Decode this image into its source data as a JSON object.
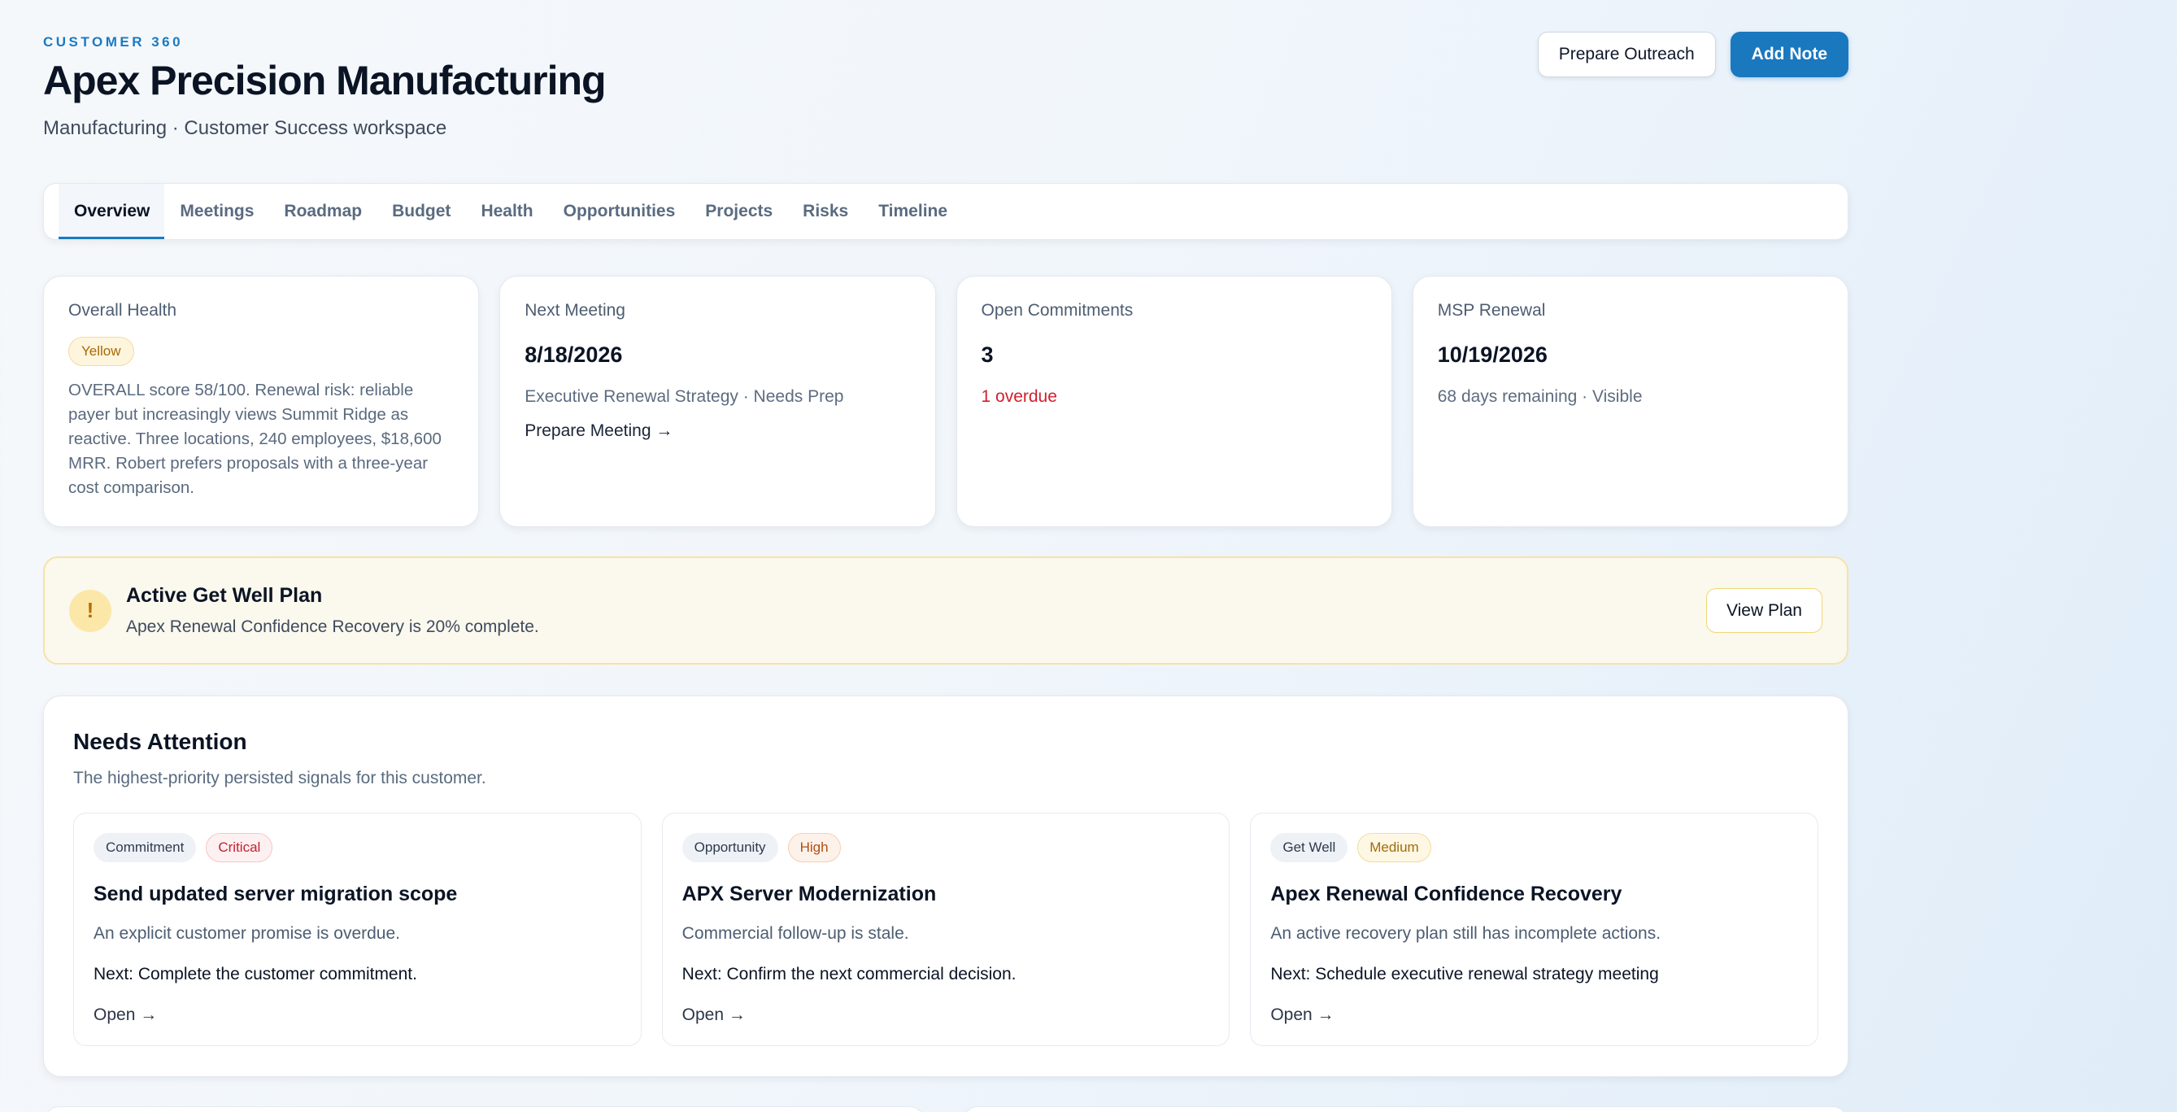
{
  "header": {
    "eyebrow": "CUSTOMER 360",
    "title": "Apex Precision Manufacturing",
    "subtitle": "Manufacturing · Customer Success workspace",
    "prepare_outreach_label": "Prepare Outreach",
    "add_note_label": "Add Note"
  },
  "tabs": [
    {
      "label": "Overview",
      "active": true
    },
    {
      "label": "Meetings"
    },
    {
      "label": "Roadmap"
    },
    {
      "label": "Budget"
    },
    {
      "label": "Health"
    },
    {
      "label": "Opportunities"
    },
    {
      "label": "Projects"
    },
    {
      "label": "Risks"
    },
    {
      "label": "Timeline"
    }
  ],
  "kpis": {
    "health": {
      "label": "Overall Health",
      "badge": "Yellow",
      "text": "OVERALL score 58/100. Renewal risk: reliable payer but increasingly views Summit Ridge as reactive. Three locations, 240 employees, $18,600 MRR. Robert prefers proposals with a three-year cost comparison."
    },
    "meeting": {
      "label": "Next Meeting",
      "value": "8/18/2026",
      "desc": "Executive Renewal Strategy · Needs Prep",
      "link": "Prepare Meeting →"
    },
    "commitments": {
      "label": "Open Commitments",
      "value": "3",
      "overdue": "1 overdue"
    },
    "renewal": {
      "label": "MSP Renewal",
      "value": "10/19/2026",
      "desc": "68 days remaining · Visible"
    }
  },
  "banner": {
    "icon": "!",
    "title": "Active Get Well Plan",
    "desc": "Apex Renewal Confidence Recovery is 20% complete.",
    "button": "View Plan"
  },
  "attention": {
    "title": "Needs Attention",
    "subtitle": "The highest-priority persisted signals for this customer.",
    "cards": [
      {
        "type": "Commitment",
        "priority": "Critical",
        "title": "Send updated server migration scope",
        "desc": "An explicit customer promise is overdue.",
        "next": "Next: Complete the customer commitment.",
        "open": "Open →"
      },
      {
        "type": "Opportunity",
        "priority": "High",
        "title": "APX Server Modernization",
        "desc": "Commercial follow-up is stale.",
        "next": "Next: Confirm the next commercial decision.",
        "open": "Open →"
      },
      {
        "type": "Get Well",
        "priority": "Medium",
        "title": "Apex Renewal Confidence Recovery",
        "desc": "An active recovery plan still has incomplete actions.",
        "next": "Next: Schedule executive renewal strategy meeting",
        "open": "Open →"
      }
    ]
  }
}
